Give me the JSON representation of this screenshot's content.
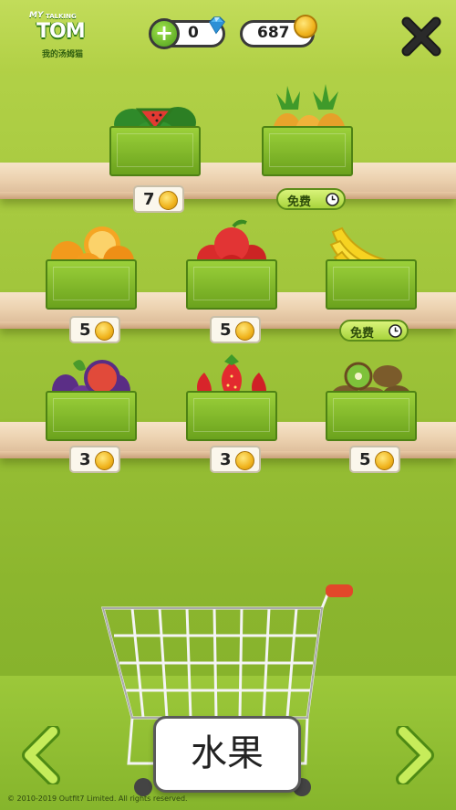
{
  "logo": {
    "my": "MY",
    "talking": "TALKING",
    "tom": "TOM",
    "subtitle": "我的汤姆猫"
  },
  "currency": {
    "gems": "0",
    "coins": "687"
  },
  "shelf_items": [
    {
      "name": "watermelon",
      "price": "7",
      "free": false
    },
    {
      "name": "pineapple",
      "price": "",
      "free": true,
      "free_label": "免费"
    },
    {
      "name": "orange",
      "price": "5",
      "free": false
    },
    {
      "name": "apple",
      "price": "5",
      "free": false
    },
    {
      "name": "banana",
      "price": "",
      "free": true,
      "free_label": "免费"
    },
    {
      "name": "fig",
      "price": "3",
      "free": false
    },
    {
      "name": "strawberry",
      "price": "3",
      "free": false
    },
    {
      "name": "kiwi",
      "price": "5",
      "free": false
    }
  ],
  "category_label": "水果",
  "copyright": "© 2010-2019 Outfit7 Limited. All rights reserved.",
  "colors": {
    "accent_green": "#8cb62e",
    "shelf": "#ecd2b0",
    "coin": "#f0b31c"
  },
  "icons": [
    "plus-icon",
    "diamond-icon",
    "coin-icon",
    "close-icon",
    "clock-icon",
    "left-arrow-icon",
    "right-arrow-icon",
    "shopping-cart-icon"
  ]
}
